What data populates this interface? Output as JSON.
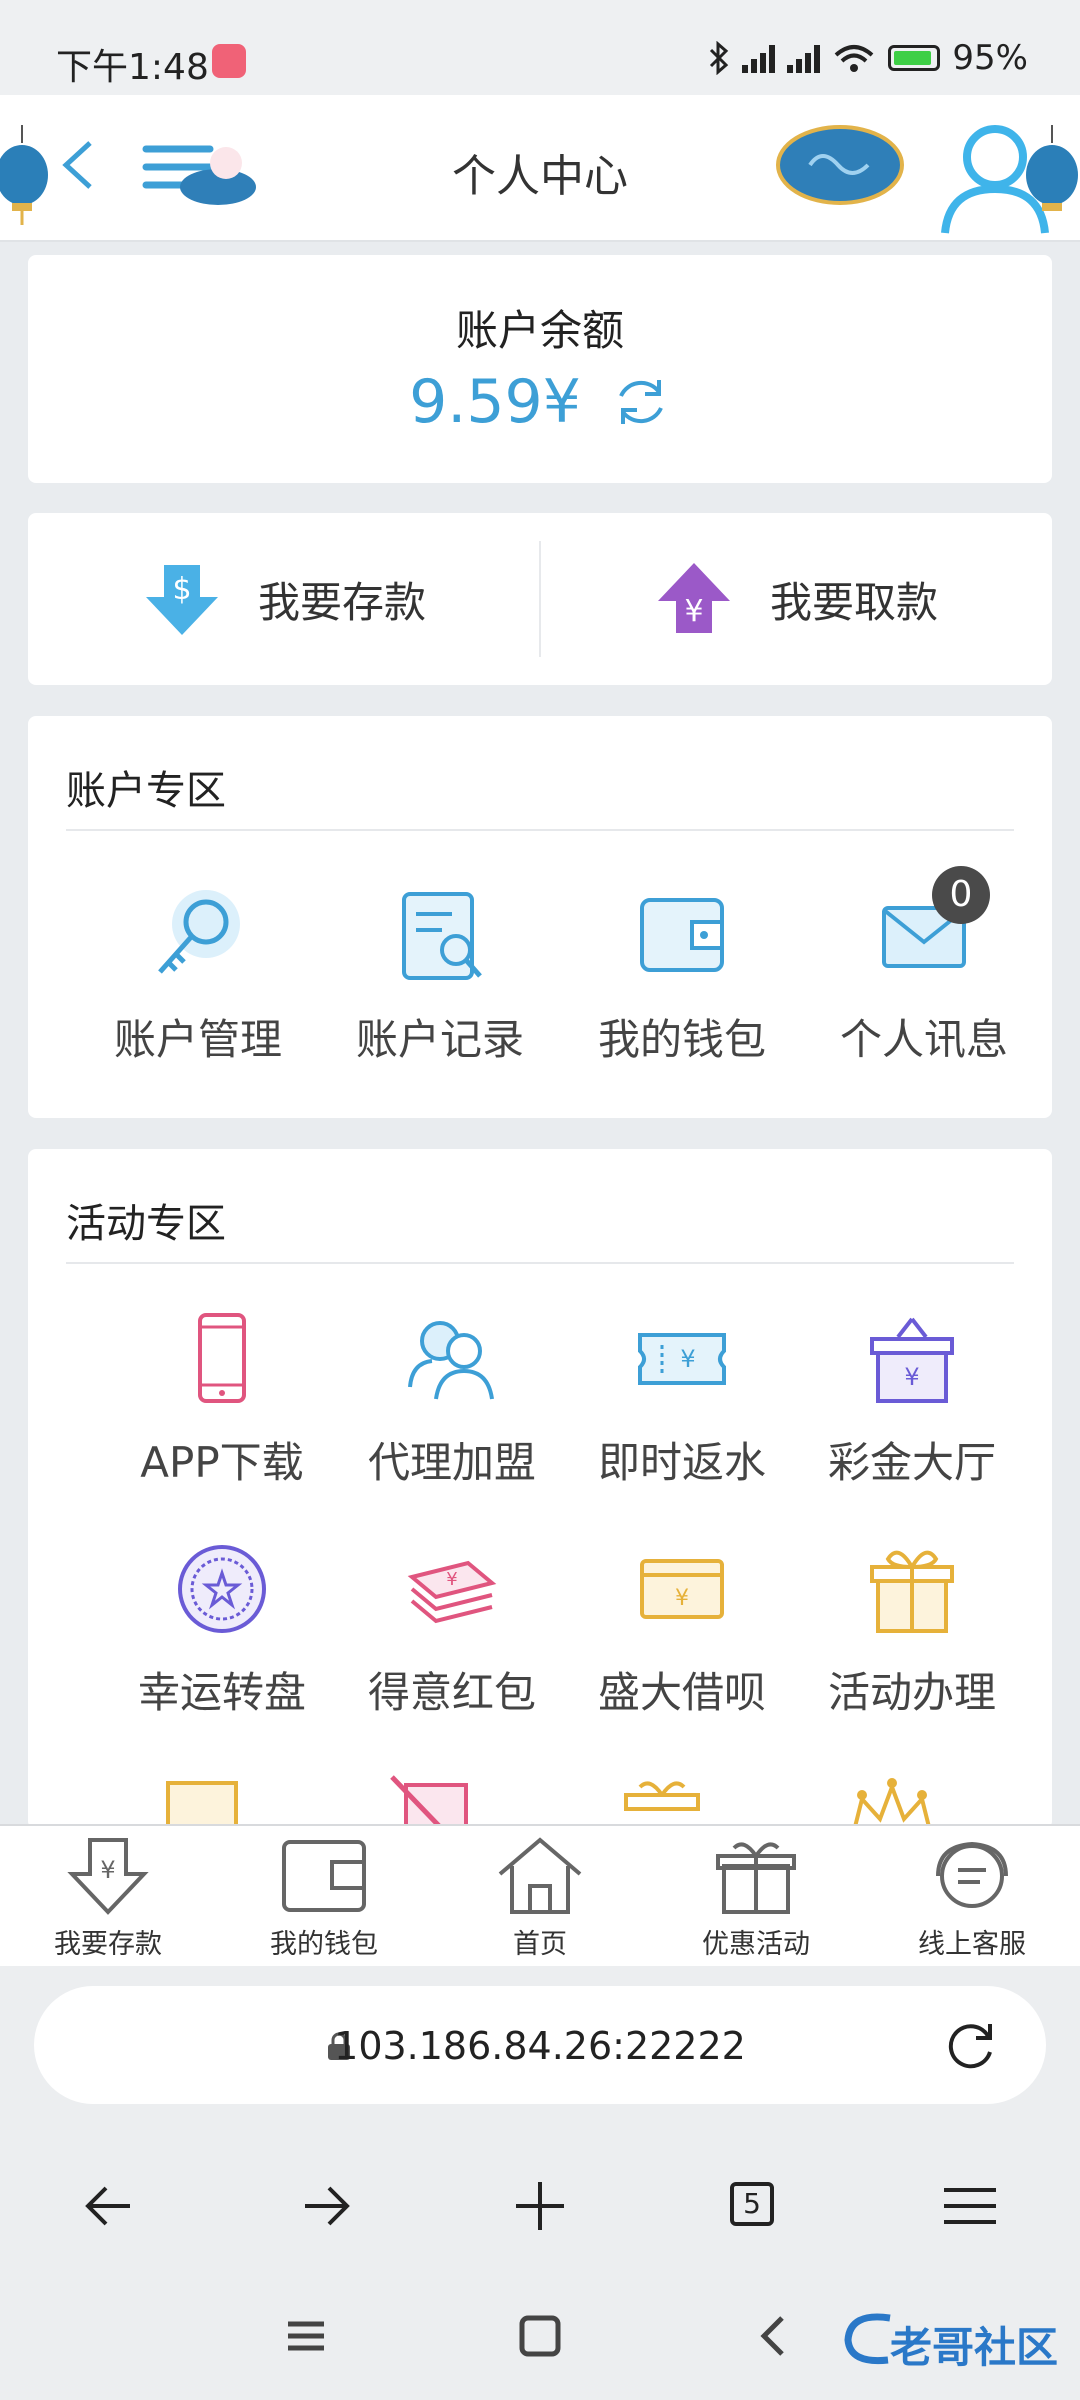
{
  "status": {
    "time": "下午1:48",
    "battery": "95%"
  },
  "header": {
    "title": "个人中心"
  },
  "balance": {
    "label": "账户余额",
    "value": "9.59¥"
  },
  "deposit_withdraw": {
    "deposit": "我要存款",
    "withdraw": "我要取款"
  },
  "account_section": {
    "title": "账户专区",
    "items": [
      {
        "label": "账户管理",
        "icon": "key-icon"
      },
      {
        "label": "账户记录",
        "icon": "record-search-icon"
      },
      {
        "label": "我的钱包",
        "icon": "wallet-icon"
      },
      {
        "label": "个人讯息",
        "icon": "mail-icon",
        "badge": "0"
      }
    ]
  },
  "activity_section": {
    "title": "活动专区",
    "items": [
      {
        "label": "APP下载",
        "icon": "phone-icon"
      },
      {
        "label": "代理加盟",
        "icon": "users-icon"
      },
      {
        "label": "即时返水",
        "icon": "ticket-icon"
      },
      {
        "label": "彩金大厅",
        "icon": "gift-icon"
      },
      {
        "label": "幸运转盘",
        "icon": "wheel-icon"
      },
      {
        "label": "得意红包",
        "icon": "money-stack-icon"
      },
      {
        "label": "盛大借呗",
        "icon": "card-icon"
      },
      {
        "label": "活动办理",
        "icon": "gift-box-icon"
      }
    ]
  },
  "tabbar": [
    {
      "label": "我要存款",
      "icon": "deposit-icon"
    },
    {
      "label": "我的钱包",
      "icon": "wallet-icon"
    },
    {
      "label": "首页",
      "icon": "home-icon"
    },
    {
      "label": "优惠活动",
      "icon": "gift-icon"
    },
    {
      "label": "线上客服",
      "icon": "chat-icon"
    }
  ],
  "browser": {
    "url": "103.186.84.26:22222",
    "tab_count": "5"
  },
  "watermark": "老哥社区",
  "colors": {
    "accent": "#3d9fd6",
    "pink": "#e0557f",
    "purple": "#6a5bd6",
    "gold": "#e6b13a"
  }
}
